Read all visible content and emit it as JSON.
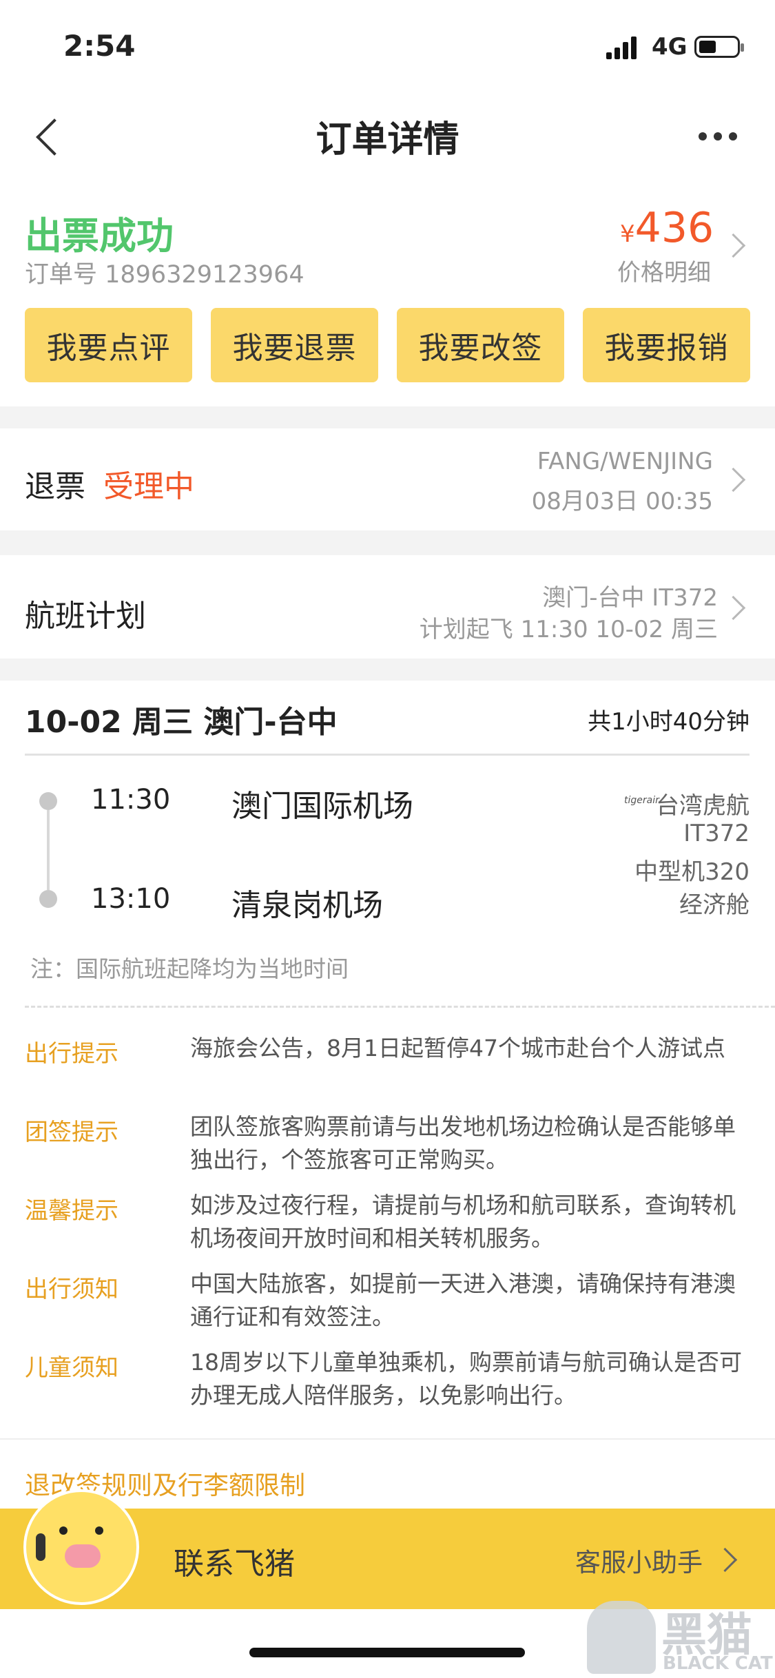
{
  "status_bar": {
    "time": "2:54",
    "network": "4G"
  },
  "header": {
    "title": "订单详情"
  },
  "order": {
    "status": "出票成功",
    "order_number": "订单号 1896329123964",
    "currency": "¥",
    "price": "436",
    "price_detail": "价格明细"
  },
  "actions": [
    "我要点评",
    "我要退票",
    "我要改签",
    "我要报销"
  ],
  "refund": {
    "label": "退票",
    "status": "受理中",
    "passenger": "FANG/WENJING",
    "time": "08月03日 00:35"
  },
  "flight_plan": {
    "label": "航班计划",
    "route": "澳门-台中 IT372",
    "departure": "计划起飞 11:30 10-02 周三"
  },
  "flight": {
    "title": "10-02 周三 澳门-台中",
    "duration": "共1小时40分钟",
    "dep_time": "11:30",
    "dep_airport": "澳门国际机场",
    "arr_time": "13:10",
    "arr_airport": "清泉岗机场",
    "airline_logo": "tigerair",
    "airline": "台湾虎航",
    "flight_no": "IT372",
    "aircraft": "中型机320",
    "cabin": "经济舱",
    "note": "注：国际航班起降均为当地时间"
  },
  "tips": [
    {
      "label": "出行提示",
      "text": "海旅会公告，8月1日起暂停47个城市赴台个人游试点"
    },
    {
      "label": "团签提示",
      "text": "团队签旅客购票前请与出发地机场边检确认是否能够单独出行，个签旅客可正常购买。"
    },
    {
      "label": "温馨提示",
      "text": "如涉及过夜行程，请提前与机场和航司联系，查询转机机场夜间开放时间和相关转机服务。"
    },
    {
      "label": "出行须知",
      "text": "中国大陆旅客，如提前一天进入港澳，请确保持有港澳通行证和有效签注。"
    },
    {
      "label": "儿童须知",
      "text": "18周岁以下儿童单独乘机，购票前请与航司确认是否可办理无成人陪伴服务，以免影响出行。"
    }
  ],
  "rules_link": "退改签规则及行李额限制",
  "contact_bar": {
    "title": "联系飞猪",
    "assistant": "客服小助手"
  },
  "watermark": {
    "cn": "黑猫",
    "en": "BLACK CAT"
  },
  "colors": {
    "green": "#52c66c",
    "orange": "#f2592a",
    "yellow": "#fbd86a",
    "tip": "#e7a021"
  }
}
